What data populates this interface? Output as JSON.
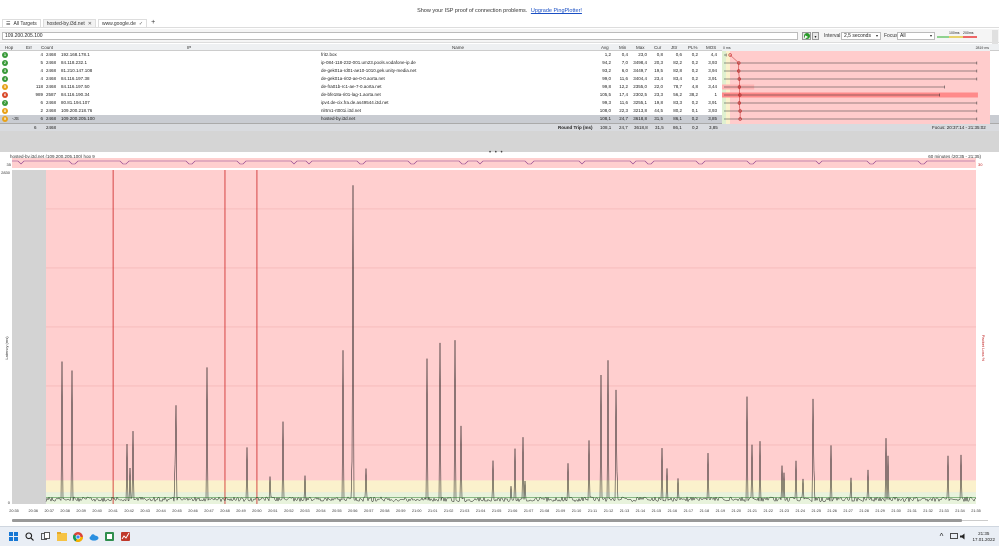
{
  "banner": {
    "text": "Show your ISP proof of connection problems.",
    "link": "Upgrade PingPlotter!"
  },
  "tabs": [
    {
      "label": "All Targets"
    },
    {
      "label": "hosted-by.i3d.net"
    },
    {
      "label": "www.google.de"
    }
  ],
  "toolbar": {
    "target": "109.200.205.100",
    "interval_label": "Interval",
    "interval_value": "2,5 seconds",
    "focus_label": "Focus",
    "focus_value": "All",
    "legend_100": "100ms",
    "legend_200": "200ms"
  },
  "columns": {
    "hop": "Hop",
    "err": "Err",
    "count": "Count",
    "ip": "IP",
    "name": "Name",
    "avg": "Avg",
    "min": "Min",
    "max": "Max",
    "cur": "Cur",
    "jttr": "Jttr",
    "pl": "PL%",
    "mos": "MOS",
    "latency": "Latency",
    "latency_left": "0 ms",
    "latency_right": "2819 ms"
  },
  "hops": [
    {
      "hop": "1",
      "err": "4",
      "count": "2468",
      "ip": "192.168.178.1",
      "name": "fritz.box",
      "avg": "1,2",
      "min": "0,4",
      "max": "23,0",
      "cur": "0,8",
      "jttr": "0,6",
      "pl": "0,2",
      "mos": "4,4",
      "status": "good",
      "bar_avg_ms": 1.2,
      "bar_max_ms": 23.0,
      "pl_value": 0.2
    },
    {
      "hop": "2",
      "err": "5",
      "count": "2468",
      "ip": "84.118.232.1",
      "name": "ip-084-118-232-001.um23.pools.vodafone-ip.de",
      "avg": "94,2",
      "min": "7,0",
      "max": "3498,4",
      "cur": "20,3",
      "jttr": "82,2",
      "pl": "0,2",
      "mos": "3,93",
      "status": "good",
      "bar_avg_ms": 94.2,
      "bar_max_ms": 2700,
      "pl_value": 0.2
    },
    {
      "hop": "3",
      "err": "4",
      "count": "2468",
      "ip": "81.210.147.108",
      "name": "de-gek01a-rd01-ae10-1010.gek.unity-media.net",
      "avg": "93,2",
      "min": "6,0",
      "max": "3449,7",
      "cur": "19,5",
      "jttr": "82,8",
      "pl": "0,2",
      "mos": "3,94",
      "status": "good",
      "bar_avg_ms": 93.2,
      "bar_max_ms": 2700,
      "pl_value": 0.2
    },
    {
      "hop": "4",
      "err": "4",
      "count": "2468",
      "ip": "84.116.197.38",
      "name": "de-gek01a-ri02-ae-0-0.aorta.net",
      "avg": "99,0",
      "min": "11,6",
      "max": "3404,4",
      "cur": "23,4",
      "jttr": "83,4",
      "pl": "0,2",
      "mos": "3,91",
      "status": "good",
      "bar_avg_ms": 99.0,
      "bar_max_ms": 2700,
      "pl_value": 0.2
    },
    {
      "hop": "5",
      "err": "118",
      "count": "2468",
      "ip": "84.116.197.50",
      "name": "de-fra01b-rc1-ae-7-0.aorta.net",
      "avg": "99,8",
      "min": "12,2",
      "max": "2355,0",
      "cur": "22,0",
      "jttr": "78,7",
      "pl": "4,8",
      "mos": "3,44",
      "status": "warn",
      "bar_avg_ms": 99.8,
      "bar_max_ms": 2355,
      "pl_value": 4.8
    },
    {
      "hop": "6",
      "err": "989",
      "count": "2587",
      "ip": "84.116.190.34",
      "name": "de-bfe18a-ri01-lag-1.aorta.net",
      "avg": "105,5",
      "min": "17,4",
      "max": "2302,5",
      "cur": "23,3",
      "jttr": "56,2",
      "pl": "38,2",
      "mos": "1",
      "status": "bad",
      "bar_avg_ms": 105.5,
      "bar_max_ms": 2302,
      "pl_value": 38.2
    },
    {
      "hop": "7",
      "err": "6",
      "count": "2468",
      "ip": "80.81.194.107",
      "name": "ipv4.de-cix.fra.de.as49544.i3d.net",
      "avg": "99,3",
      "min": "11,6",
      "max": "3255,1",
      "cur": "19,8",
      "jttr": "83,3",
      "pl": "0,2",
      "mos": "3,91",
      "status": "good",
      "bar_avg_ms": 99.3,
      "bar_max_ms": 2700,
      "pl_value": 0.2
    },
    {
      "hop": "8",
      "err": "2",
      "count": "2468",
      "ip": "109.200.218.76",
      "name": "nlrtm1-rt001i.i3d.net",
      "avg": "108,0",
      "min": "22,3",
      "max": "3213,8",
      "cur": "44,5",
      "jttr": "80,2",
      "pl": "0,1",
      "mos": "3,93",
      "status": "warn",
      "bar_avg_ms": 108.0,
      "bar_max_ms": 2700,
      "pl_value": 0.1
    },
    {
      "hop": "9",
      "err": "6",
      "count": "2468",
      "ip": "109.200.205.100",
      "name": "hosted-by.i3d.net",
      "avg": "108,1",
      "min": "24,7",
      "max": "3618,8",
      "cur": "31,5",
      "jttr": "86,1",
      "pl": "0,2",
      "mos": "3,85",
      "status": "warn",
      "bar_avg_ms": 108.1,
      "bar_max_ms": 2700,
      "pl_value": 0.2,
      "selected": true,
      "hop_note": "-JS"
    }
  ],
  "summary": {
    "err": "6",
    "count": "2468",
    "label": "Round Trip (ms)",
    "avg": "108,1",
    "min": "24,7",
    "max": "3618,8",
    "cur": "31,5",
    "jttr": "86,1",
    "pl": "0,2",
    "mos": "3,85",
    "focus": "Focus: 20:37:14 - 21:35:02"
  },
  "timeline": {
    "title": "hosted-by.i3d.net (109.200.205.100) hop 9",
    "range": "60 minutes (20:35 - 21:35)",
    "y_top_label": "2830",
    "y_zero_label": "0",
    "y_label": "Latency (ms)",
    "y2_label": "Packet Loss %",
    "pl_top_label": "35",
    "pl_right_label": "30",
    "time_labels": [
      "20:35",
      "20:36",
      "20:37",
      "20:38",
      "20:39",
      "20:40",
      "20:41",
      "20:42",
      "20:43",
      "20:44",
      "20:45",
      "20:46",
      "20:47",
      "20:48",
      "20:49",
      "20:50",
      "20:51",
      "20:52",
      "20:53",
      "20:54",
      "20:55",
      "20:56",
      "20:57",
      "20:58",
      "20:59",
      "21:00",
      "21:01",
      "21:02",
      "21:03",
      "21:04",
      "21:05",
      "21:06",
      "21:07",
      "21:08",
      "21:09",
      "21:10",
      "21:11",
      "21:12",
      "21:13",
      "21:14",
      "21:15",
      "21:16",
      "21:17",
      "21:18",
      "21:19",
      "21:20",
      "21:21",
      "21:22",
      "21:23",
      "21:24",
      "21:25",
      "21:26",
      "21:27",
      "21:28",
      "21:29",
      "21:30",
      "21:31",
      "21:32",
      "21:33",
      "21:34",
      "21:35"
    ],
    "packet_loss_minutes": [
      "20:41",
      "20:48",
      "20:50"
    ],
    "spike_peak_minute": "20:56",
    "colors": {
      "good": "#e8f3dc",
      "warn": "#fbf1cc",
      "bad": "#ffcfcf",
      "line": "#1a1a1a",
      "loss": "#cc2222"
    }
  },
  "clock": {
    "time": "21:35",
    "date": "17.01.2022"
  }
}
